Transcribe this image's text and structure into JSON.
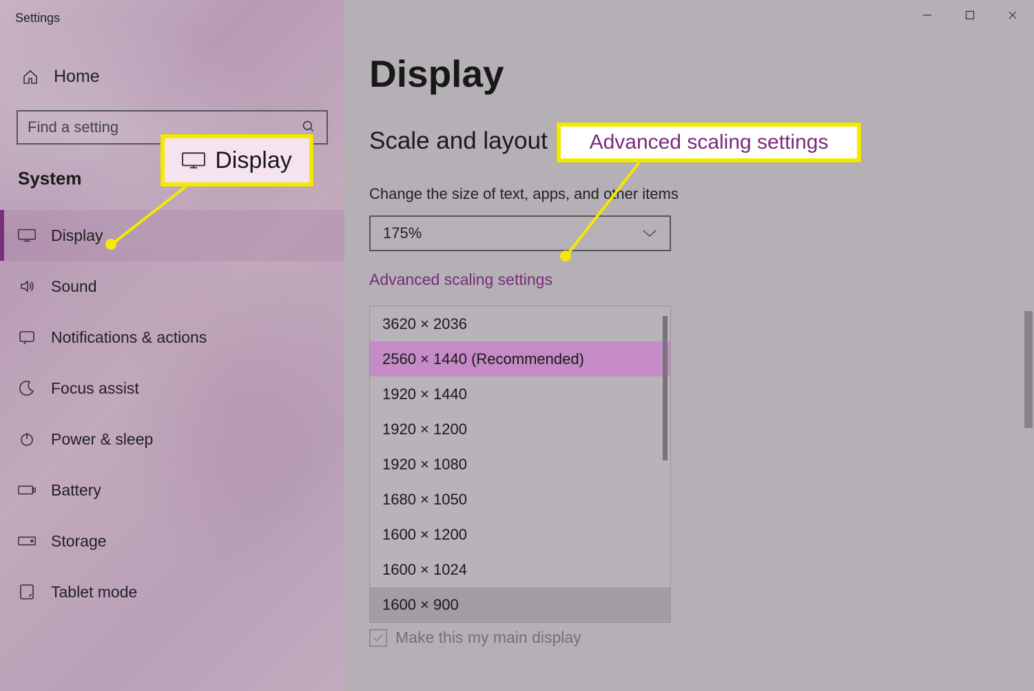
{
  "app": {
    "title": "Settings"
  },
  "sidebar": {
    "home_label": "Home",
    "search_placeholder": "Find a setting",
    "section_label": "System",
    "items": [
      {
        "label": "Display",
        "icon": "display-icon",
        "active": true
      },
      {
        "label": "Sound",
        "icon": "sound-icon"
      },
      {
        "label": "Notifications & actions",
        "icon": "notifications-icon"
      },
      {
        "label": "Focus assist",
        "icon": "moon-icon"
      },
      {
        "label": "Power & sleep",
        "icon": "power-icon"
      },
      {
        "label": "Battery",
        "icon": "battery-icon"
      },
      {
        "label": "Storage",
        "icon": "storage-icon"
      },
      {
        "label": "Tablet mode",
        "icon": "tablet-icon"
      }
    ]
  },
  "main": {
    "page_title": "Display",
    "section_heading": "Scale and layout",
    "scale_field_label": "Change the size of text, apps, and other items",
    "scale_value": "175%",
    "advanced_link": "Advanced scaling settings",
    "resolution_options": [
      "3620 × 2036",
      "2560 × 1440 (Recommended)",
      "1920 × 1440",
      "1920 × 1200",
      "1920 × 1080",
      "1680 × 1050",
      "1600 × 1200",
      "1600 × 1024",
      "1600 × 900"
    ],
    "resolution_selected_index": 1,
    "resolution_hover_index": 8,
    "main_display_checkbox": "Make this my main display"
  },
  "callouts": {
    "display_label": "Display",
    "advanced_label": "Advanced scaling settings"
  },
  "colors": {
    "accent": "#7a2a7a",
    "highlight": "#f2ea00",
    "selected_bg": "#c48bc7"
  }
}
